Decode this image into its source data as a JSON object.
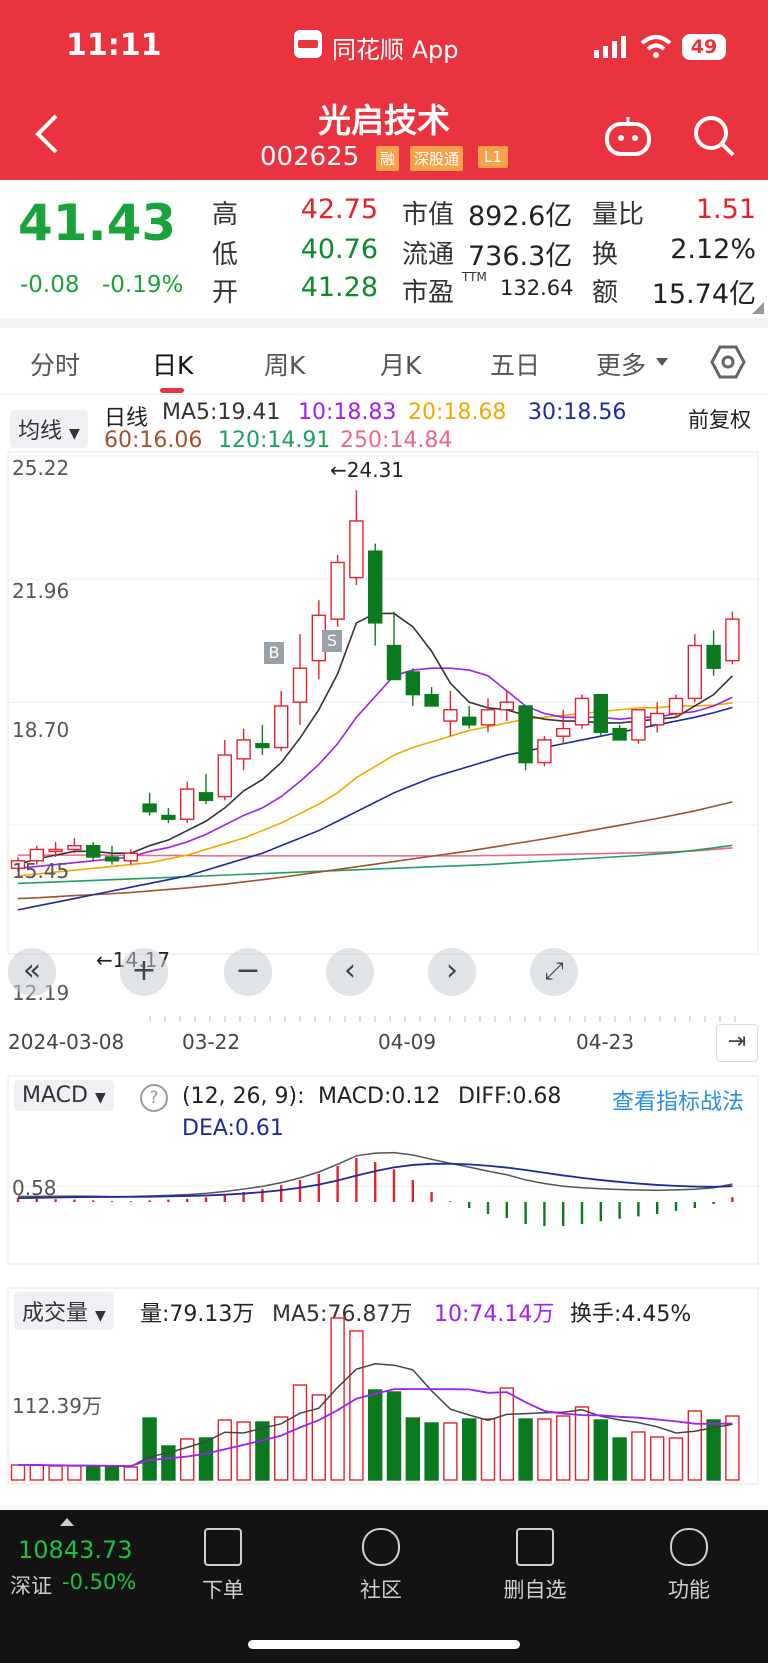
{
  "status_bar": {
    "time": "11:11",
    "app": "同花顺 App",
    "battery": "49"
  },
  "header": {
    "title": "光启技术",
    "code": "002625",
    "badges": [
      "融",
      "深股通",
      "L1"
    ]
  },
  "quote": {
    "price": "41.43",
    "change": "-0.08",
    "change_pct": "-0.19%",
    "high_label": "高",
    "high": "42.75",
    "low_label": "低",
    "low": "40.76",
    "open_label": "开",
    "open": "41.28",
    "mktcap_label": "市值",
    "mktcap": "892.6亿",
    "float_label": "流通",
    "float": "736.3亿",
    "pe_label": "市盈",
    "pe_sup": "TTM",
    "pe": "132.64",
    "volratio_label": "量比",
    "volratio": "1.51",
    "turnover_label": "换",
    "turnover": "2.12%",
    "amount_label": "额",
    "amount": "15.74亿"
  },
  "tabs": [
    "分时",
    "日K",
    "周K",
    "月K",
    "五日",
    "更多"
  ],
  "active_tab": "日K",
  "ma_legend": {
    "pill": "均线",
    "line_label": "日线",
    "ma5": "MA5:19.41",
    "ma10": "10:18.83",
    "ma20": "20:18.68",
    "ma30": "30:18.56",
    "ma60": "60:16.06",
    "ma120": "120:14.91",
    "ma250": "250:14.84",
    "adjust": "前复权"
  },
  "kline": {
    "y_labels": [
      "25.22",
      "21.96",
      "18.70",
      "15.45",
      "12.19"
    ],
    "x_labels": [
      "2024-03-08",
      "03-22",
      "04-09",
      "04-23"
    ],
    "max_note": "←24.31",
    "min_note": "←14.17",
    "buy_mark": "B",
    "sell_mark": "S"
  },
  "chart_data": {
    "type": "candlestick",
    "candles": [
      [
        14.3,
        14.6,
        14.2,
        14.5
      ],
      [
        14.5,
        14.9,
        14.4,
        14.8
      ],
      [
        14.8,
        15.0,
        14.6,
        14.8
      ],
      [
        14.8,
        15.1,
        14.7,
        14.9
      ],
      [
        14.9,
        15.0,
        14.5,
        14.6
      ],
      [
        14.6,
        14.9,
        14.4,
        14.5
      ],
      [
        14.5,
        14.8,
        14.4,
        14.7
      ],
      [
        16.0,
        16.3,
        15.7,
        15.8
      ],
      [
        15.7,
        15.9,
        15.5,
        15.6
      ],
      [
        15.6,
        16.6,
        15.5,
        16.4
      ],
      [
        16.3,
        16.8,
        16.0,
        16.1
      ],
      [
        16.2,
        17.7,
        16.1,
        17.3
      ],
      [
        17.2,
        18.0,
        16.9,
        17.7
      ],
      [
        17.6,
        18.1,
        17.3,
        17.5
      ],
      [
        17.5,
        19.0,
        17.4,
        18.6
      ],
      [
        18.7,
        20.5,
        18.1,
        19.6
      ],
      [
        19.8,
        21.4,
        19.3,
        21.0
      ],
      [
        20.9,
        22.6,
        20.7,
        22.4
      ],
      [
        22.0,
        24.31,
        21.8,
        23.5
      ],
      [
        22.7,
        22.9,
        20.2,
        20.8
      ],
      [
        20.2,
        21.1,
        19.3,
        19.3
      ],
      [
        19.5,
        19.6,
        18.6,
        18.9
      ],
      [
        18.9,
        19.1,
        18.6,
        18.6
      ],
      [
        18.2,
        19.0,
        17.8,
        18.5
      ],
      [
        18.3,
        18.6,
        18.0,
        18.1
      ],
      [
        18.1,
        18.8,
        17.9,
        18.5
      ],
      [
        18.5,
        19.0,
        18.2,
        18.7
      ],
      [
        18.6,
        18.6,
        16.9,
        17.1
      ],
      [
        17.1,
        17.8,
        17.0,
        17.7
      ],
      [
        17.8,
        18.5,
        17.6,
        18.0
      ],
      [
        18.1,
        18.9,
        18.0,
        18.8
      ],
      [
        18.9,
        18.9,
        17.8,
        17.9
      ],
      [
        18.0,
        18.1,
        17.7,
        17.7
      ],
      [
        17.7,
        18.5,
        17.6,
        18.5
      ],
      [
        18.1,
        18.7,
        17.9,
        18.4
      ],
      [
        18.4,
        18.9,
        18.3,
        18.8
      ],
      [
        18.8,
        20.5,
        18.7,
        20.2
      ],
      [
        20.2,
        20.6,
        19.4,
        19.6
      ],
      [
        19.8,
        21.1,
        19.7,
        20.9
      ]
    ],
    "ma5": [
      14.4,
      14.55,
      14.65,
      14.75,
      14.75,
      14.7,
      14.7,
      14.9,
      15.05,
      15.3,
      15.55,
      15.9,
      16.35,
      16.65,
      17.1,
      17.75,
      18.5,
      19.45,
      20.8,
      21.05,
      21.05,
      20.7,
      20.05,
      19.2,
      18.7,
      18.55,
      18.5,
      18.35,
      18.25,
      18.2,
      18.2,
      18.15,
      18.15,
      18.2,
      18.25,
      18.3,
      18.6,
      18.9,
      19.4
    ],
    "ma10": [
      14.3,
      14.35,
      14.4,
      14.45,
      14.5,
      14.55,
      14.6,
      14.75,
      14.85,
      15.0,
      15.2,
      15.45,
      15.7,
      15.9,
      16.2,
      16.6,
      17.05,
      17.6,
      18.3,
      18.85,
      19.4,
      19.55,
      19.6,
      19.6,
      19.55,
      19.4,
      19.0,
      18.6,
      18.4,
      18.3,
      18.3,
      18.3,
      18.25,
      18.3,
      18.3,
      18.4,
      18.45,
      18.6,
      18.83
    ],
    "ma20": [
      14.1,
      14.15,
      14.2,
      14.25,
      14.3,
      14.35,
      14.4,
      14.45,
      14.55,
      14.65,
      14.8,
      14.95,
      15.1,
      15.3,
      15.5,
      15.75,
      16.0,
      16.3,
      16.7,
      17.0,
      17.3,
      17.5,
      17.65,
      17.8,
      17.95,
      18.05,
      18.15,
      18.25,
      18.3,
      18.35,
      18.4,
      18.45,
      18.5,
      18.55,
      18.55,
      18.6,
      18.6,
      18.62,
      18.68
    ],
    "ma30": [
      13.2,
      13.3,
      13.4,
      13.5,
      13.6,
      13.7,
      13.8,
      13.9,
      14.0,
      14.1,
      14.25,
      14.4,
      14.55,
      14.7,
      14.9,
      15.1,
      15.3,
      15.55,
      15.8,
      16.05,
      16.3,
      16.5,
      16.7,
      16.85,
      17.0,
      17.15,
      17.3,
      17.4,
      17.5,
      17.6,
      17.7,
      17.8,
      17.9,
      18.0,
      18.1,
      18.2,
      18.3,
      18.42,
      18.56
    ],
    "ma60": [
      13.5,
      13.52,
      13.55,
      13.58,
      13.6,
      13.63,
      13.66,
      13.7,
      13.74,
      13.78,
      13.83,
      13.88,
      13.94,
      14.0,
      14.06,
      14.13,
      14.2,
      14.27,
      14.34,
      14.41,
      14.48,
      14.55,
      14.62,
      14.69,
      14.76,
      14.84,
      14.92,
      15.0,
      15.08,
      15.17,
      15.26,
      15.35,
      15.44,
      15.53,
      15.62,
      15.72,
      15.82,
      15.94,
      16.06
    ],
    "ma120": [
      13.9,
      13.92,
      13.94,
      13.96,
      13.98,
      14.0,
      14.02,
      14.04,
      14.06,
      14.08,
      14.1,
      14.12,
      14.14,
      14.16,
      14.18,
      14.2,
      14.22,
      14.24,
      14.26,
      14.28,
      14.3,
      14.32,
      14.34,
      14.36,
      14.38,
      14.4,
      14.43,
      14.46,
      14.49,
      14.52,
      14.55,
      14.58,
      14.61,
      14.64,
      14.68,
      14.72,
      14.78,
      14.84,
      14.91
    ],
    "ma250": [
      14.65,
      14.65,
      14.65,
      14.65,
      14.65,
      14.65,
      14.64,
      14.64,
      14.64,
      14.64,
      14.63,
      14.63,
      14.63,
      14.63,
      14.63,
      14.63,
      14.63,
      14.63,
      14.63,
      14.63,
      14.63,
      14.63,
      14.63,
      14.63,
      14.63,
      14.64,
      14.64,
      14.65,
      14.66,
      14.67,
      14.68,
      14.69,
      14.7,
      14.71,
      14.72,
      14.74,
      14.76,
      14.8,
      14.84
    ],
    "macd_hist": [
      0.1,
      0.08,
      0.07,
      0.06,
      0.04,
      0.02,
      0.02,
      0.04,
      0.06,
      0.08,
      0.12,
      0.18,
      0.25,
      0.32,
      0.42,
      0.55,
      0.7,
      0.9,
      1.1,
      1.0,
      0.82,
      0.55,
      0.25,
      0.02,
      -0.15,
      -0.3,
      -0.4,
      -0.55,
      -0.6,
      -0.6,
      -0.55,
      -0.48,
      -0.42,
      -0.36,
      -0.3,
      -0.22,
      -0.15,
      -0.05,
      0.12
    ],
    "volume": [
      15,
      15,
      14,
      14,
      14,
      13,
      13,
      62,
      34,
      41,
      42,
      60,
      58,
      58,
      63,
      95,
      85,
      162,
      149,
      90,
      88,
      62,
      57,
      57,
      61,
      61,
      92,
      61,
      61,
      64,
      73,
      60,
      42,
      48,
      43,
      42,
      69,
      60,
      64
    ]
  },
  "macd": {
    "pill": "MACD",
    "params": "(12, 26, 9):",
    "macd": "MACD:0.12",
    "diff": "DIFF:0.68",
    "dea": "DEA:0.61",
    "link": "查看指标战法",
    "y_label": "0.58"
  },
  "volume": {
    "pill": "成交量",
    "vol": "量:79.13万",
    "ma5": "MA5:76.87万",
    "ma10": "10:74.14万",
    "turnover": "换手:4.45%",
    "y_label": "112.39万"
  },
  "bottom": {
    "index_value": "10843.73",
    "index_name": "深证",
    "index_change": "-0.50%",
    "nav": [
      "下单",
      "社区",
      "删自选",
      "功能"
    ]
  },
  "colors": {
    "header": "#e93440",
    "up": "#e8202a",
    "down": "#0b7a1e",
    "ma5": "#333333",
    "ma10": "#a020f0",
    "ma20": "#f2a900",
    "ma30": "#1e2a9e",
    "ma60": "#a0522d",
    "ma120": "#20a060",
    "ma250": "#ee6688"
  }
}
